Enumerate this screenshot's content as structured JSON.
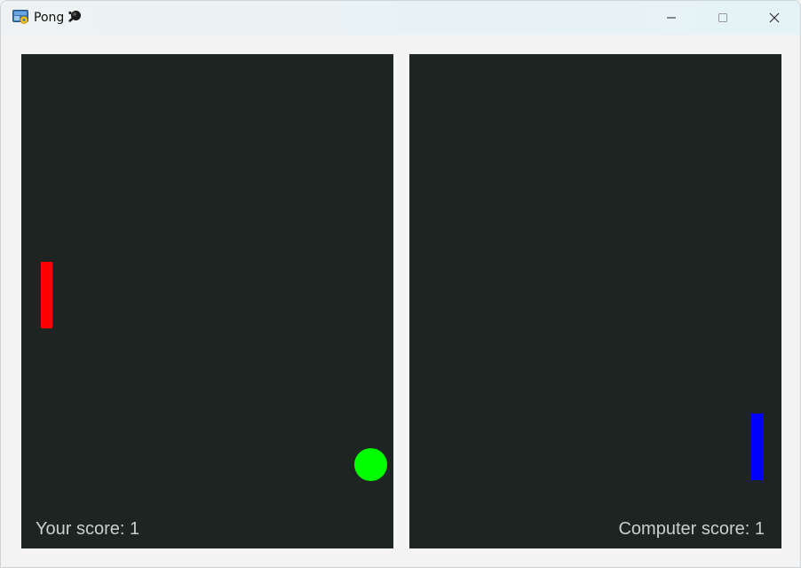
{
  "window": {
    "title": "Pong",
    "icons": {
      "app": "python-icon",
      "title_emoji": "ping-pong-paddle-icon",
      "minimize": "minimize-icon",
      "maximize": "maximize-icon",
      "close": "close-icon"
    }
  },
  "colors": {
    "field": "#1d2422",
    "player_paddle": "#ff0000",
    "computer_paddle": "#0000ff",
    "ball": "#00ff00",
    "score_text": "#c9cfcd"
  },
  "game": {
    "player_score_text": "Your score: 1",
    "computer_score_text": "Computer score: 1"
  }
}
